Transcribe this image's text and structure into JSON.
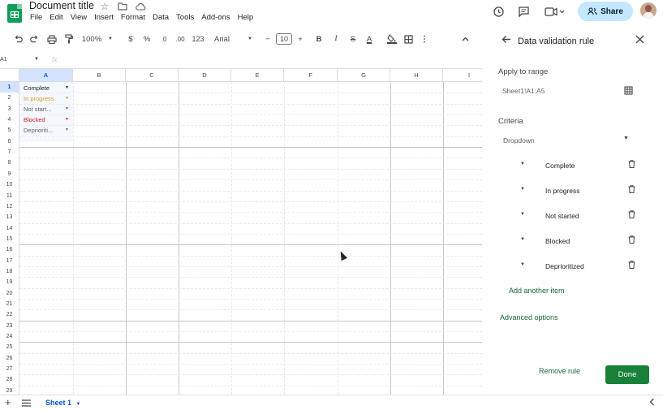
{
  "titlebar": {
    "doc_title": "Document title",
    "menu": [
      "File",
      "Edit",
      "View",
      "Insert",
      "Format",
      "Data",
      "Tools",
      "Add-ons",
      "Help"
    ],
    "share_label": "Share"
  },
  "toolbar": {
    "zoom": "100%",
    "currency": "$",
    "percent": "%",
    "dec_decrease": ".0",
    "dec_increase": ".00",
    "number_format": "123",
    "font": "Arial",
    "minus": "−",
    "font_size": "10",
    "plus": "+",
    "bold": "B",
    "italic": "I",
    "strike": "S",
    "text_color": "A"
  },
  "formula": {
    "namebox": "A1",
    "fx": "fx"
  },
  "grid": {
    "columns": [
      "A",
      "B",
      "C",
      "D",
      "E",
      "F",
      "G",
      "H",
      "I"
    ],
    "rows": [
      "1",
      "2",
      "3",
      "4",
      "5",
      "6",
      "7",
      "8",
      "9",
      "10",
      "11",
      "12",
      "13",
      "14",
      "15",
      "16",
      "17",
      "18",
      "19",
      "20",
      "21",
      "22",
      "23",
      "24",
      "25",
      "26",
      "27",
      "28",
      "29"
    ],
    "cells": [
      {
        "text": "Complete",
        "color": "#202124"
      },
      {
        "text": "In progress",
        "color": "#c9a227"
      },
      {
        "text": "Not start...",
        "color": "#5f6368"
      },
      {
        "text": "Blocked",
        "color": "#c5221f"
      },
      {
        "text": "Deprioriti...",
        "color": "#5f6368"
      }
    ]
  },
  "bottom": {
    "sheet_tab": "Sheet 1"
  },
  "panel": {
    "title": "Data validation rule",
    "apply_label": "Apply to range",
    "range_value": "Sheet1!A1:A5",
    "criteria_label": "Criteria",
    "criteria_value": "Dropdown",
    "items": [
      "Complete",
      "In progress",
      "Not started",
      "Blocked",
      "Deprioritized"
    ],
    "add_item": "Add another item",
    "advanced": "Advanced options",
    "remove": "Remove rule",
    "done": "Done"
  },
  "colors": {
    "accent_green": "#188038",
    "share_blue": "#c2e7ff",
    "selected_blue": "#d3e3fd"
  }
}
